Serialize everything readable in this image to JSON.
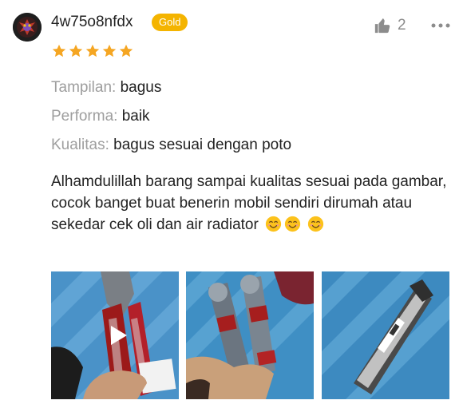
{
  "review": {
    "username": "4w75o8nfdx",
    "tier_badge": "Gold",
    "rating": 5,
    "like_count": "2",
    "attributes": [
      {
        "label": "Tampilan:",
        "value": "bagus"
      },
      {
        "label": "Performa:",
        "value": "baik"
      },
      {
        "label": "Kualitas:",
        "value": "bagus sesuai dengan poto"
      }
    ],
    "comment": "Alhamdulillah barang sampai kualitas sesuai pada gambar, cocok banget buat benerin mobil sendiri dirumah atau sekedar cek oli dan air radiator",
    "comment_emojis": [
      "smiling-face",
      "smiling-face",
      "smiling-face"
    ],
    "media": [
      {
        "kind": "video",
        "icon": "play-icon"
      },
      {
        "kind": "photo"
      },
      {
        "kind": "photo"
      }
    ]
  },
  "colors": {
    "badge_gold": "#f4b400",
    "star": "#f5a623",
    "label_gray": "#9e9e9e",
    "text": "#222222"
  },
  "icons": {
    "like": "thumbs-up-icon",
    "more": "more-options-icon",
    "star": "star-icon"
  }
}
